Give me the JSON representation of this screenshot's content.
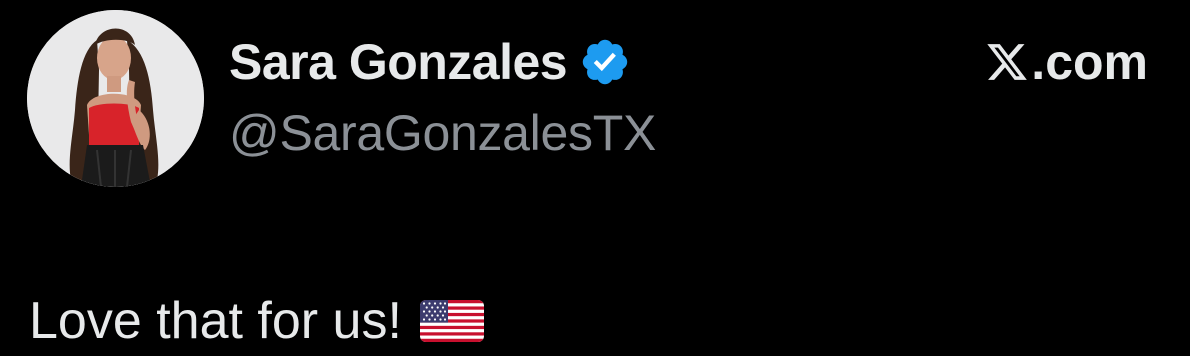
{
  "author": {
    "display_name": "Sara Gonzales",
    "handle": "@SaraGonzalesTX",
    "verified_badge_icon": "verified-badge-icon",
    "verified_color": "#1d9bf0",
    "avatar_icon": "profile-avatar"
  },
  "brand": {
    "logo_icon": "x-logo-icon",
    "suffix": ".com"
  },
  "post": {
    "text": "Love that for us!",
    "emoji_icon": "us-flag-emoji"
  },
  "colors": {
    "background": "#000000",
    "primary_text": "#e7e9ea",
    "secondary_text": "#8b9096"
  }
}
